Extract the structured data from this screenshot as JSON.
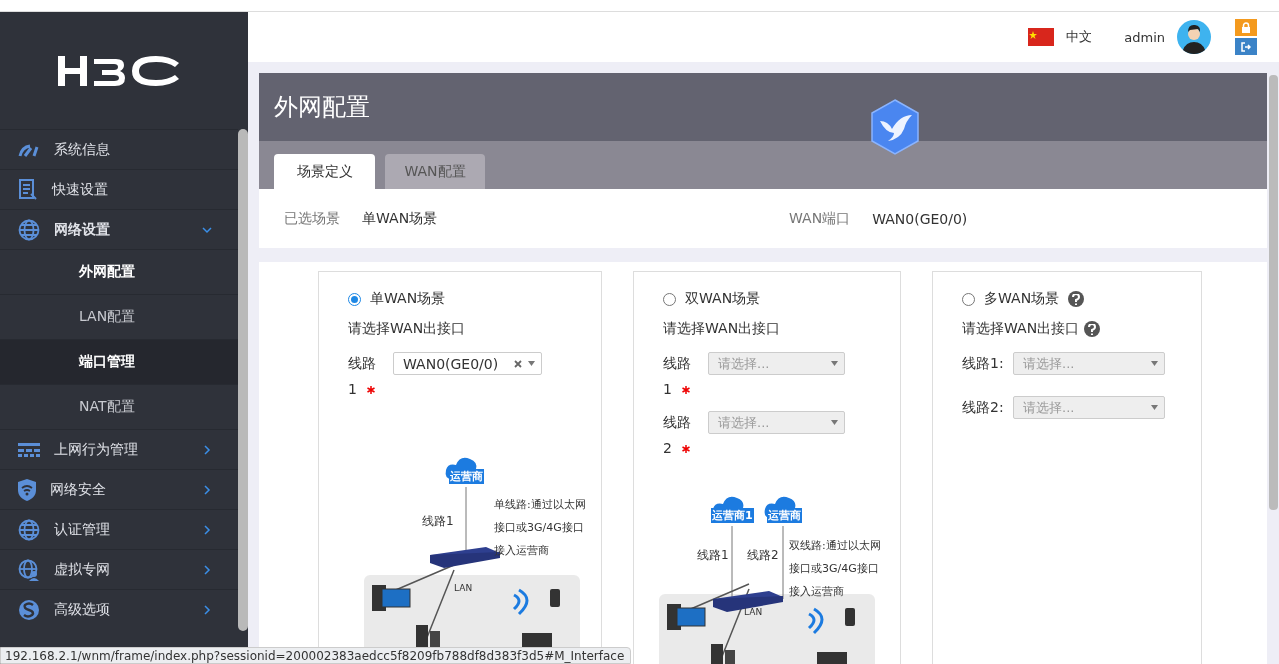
{
  "header": {
    "language": "中文",
    "user": "admin"
  },
  "sidebar": {
    "items": [
      {
        "label": "系统信息",
        "expanded": false
      },
      {
        "label": "快速设置",
        "expanded": false
      },
      {
        "label": "网络设置",
        "expanded": true,
        "children": [
          {
            "label": "外网配置",
            "selected": true,
            "highlighted": false
          },
          {
            "label": "LAN配置",
            "selected": false,
            "highlighted": false
          },
          {
            "label": "端口管理",
            "selected": false,
            "highlighted": true
          },
          {
            "label": "NAT配置",
            "selected": false,
            "highlighted": false
          }
        ]
      },
      {
        "label": "上网行为管理",
        "expanded": false
      },
      {
        "label": "网络安全",
        "expanded": false
      },
      {
        "label": "认证管理",
        "expanded": false
      },
      {
        "label": "虚拟专网",
        "expanded": false
      },
      {
        "label": "高级选项",
        "expanded": false
      }
    ]
  },
  "page": {
    "title": "外网配置",
    "tabs": [
      {
        "label": "场景定义",
        "selected": true
      },
      {
        "label": "WAN配置",
        "selected": false
      }
    ],
    "summary": [
      {
        "label": "已选场景",
        "value": "单WAN场景"
      },
      {
        "label": "WAN端口",
        "value": "WAN0(GE0/0)"
      }
    ],
    "scenarios": [
      {
        "title": "单WAN场景",
        "selected": true,
        "help": false,
        "subtitle": "请选择WAN出接口",
        "subtitle_help": false,
        "lines": [
          {
            "label": "线路",
            "number": "1",
            "required": true,
            "value": "WAN0(GE0/0)",
            "disabled": false
          }
        ],
        "diagram": {
          "kind": "single",
          "clouds": [
            "运营商"
          ],
          "links": [
            "线路1"
          ],
          "lan": "LAN",
          "description": "单线路:通过以太网接口或3G/4G接口接入运营商"
        }
      },
      {
        "title": "双WAN场景",
        "selected": false,
        "help": false,
        "subtitle": "请选择WAN出接口",
        "subtitle_help": false,
        "lines": [
          {
            "label": "线路",
            "number": "1",
            "required": true,
            "placeholder": "请选择...",
            "disabled": true
          },
          {
            "label": "线路",
            "number": "2",
            "required": true,
            "placeholder": "请选择...",
            "disabled": true
          }
        ],
        "diagram": {
          "kind": "dual",
          "clouds": [
            "运营商1",
            "运营商"
          ],
          "links": [
            "线路1",
            "线路2"
          ],
          "lan": "LAN",
          "description": "双线路:通过以太网接口或3G/4G接口接入运营商"
        }
      },
      {
        "title": "多WAN场景",
        "selected": false,
        "help": true,
        "subtitle": "请选择WAN出接口",
        "subtitle_help": true,
        "lines": [
          {
            "label": "线路1:",
            "required": false,
            "placeholder": "请选择...",
            "disabled": true
          },
          {
            "label": "线路2:",
            "required": false,
            "placeholder": "请选择...",
            "disabled": true
          }
        ]
      }
    ]
  },
  "status_bar": {
    "url": "192.168.2.1/wnm/frame/index.php?sessionid=200002383aedcc5f8209fb788df8d383f3d5#M_Interface"
  }
}
